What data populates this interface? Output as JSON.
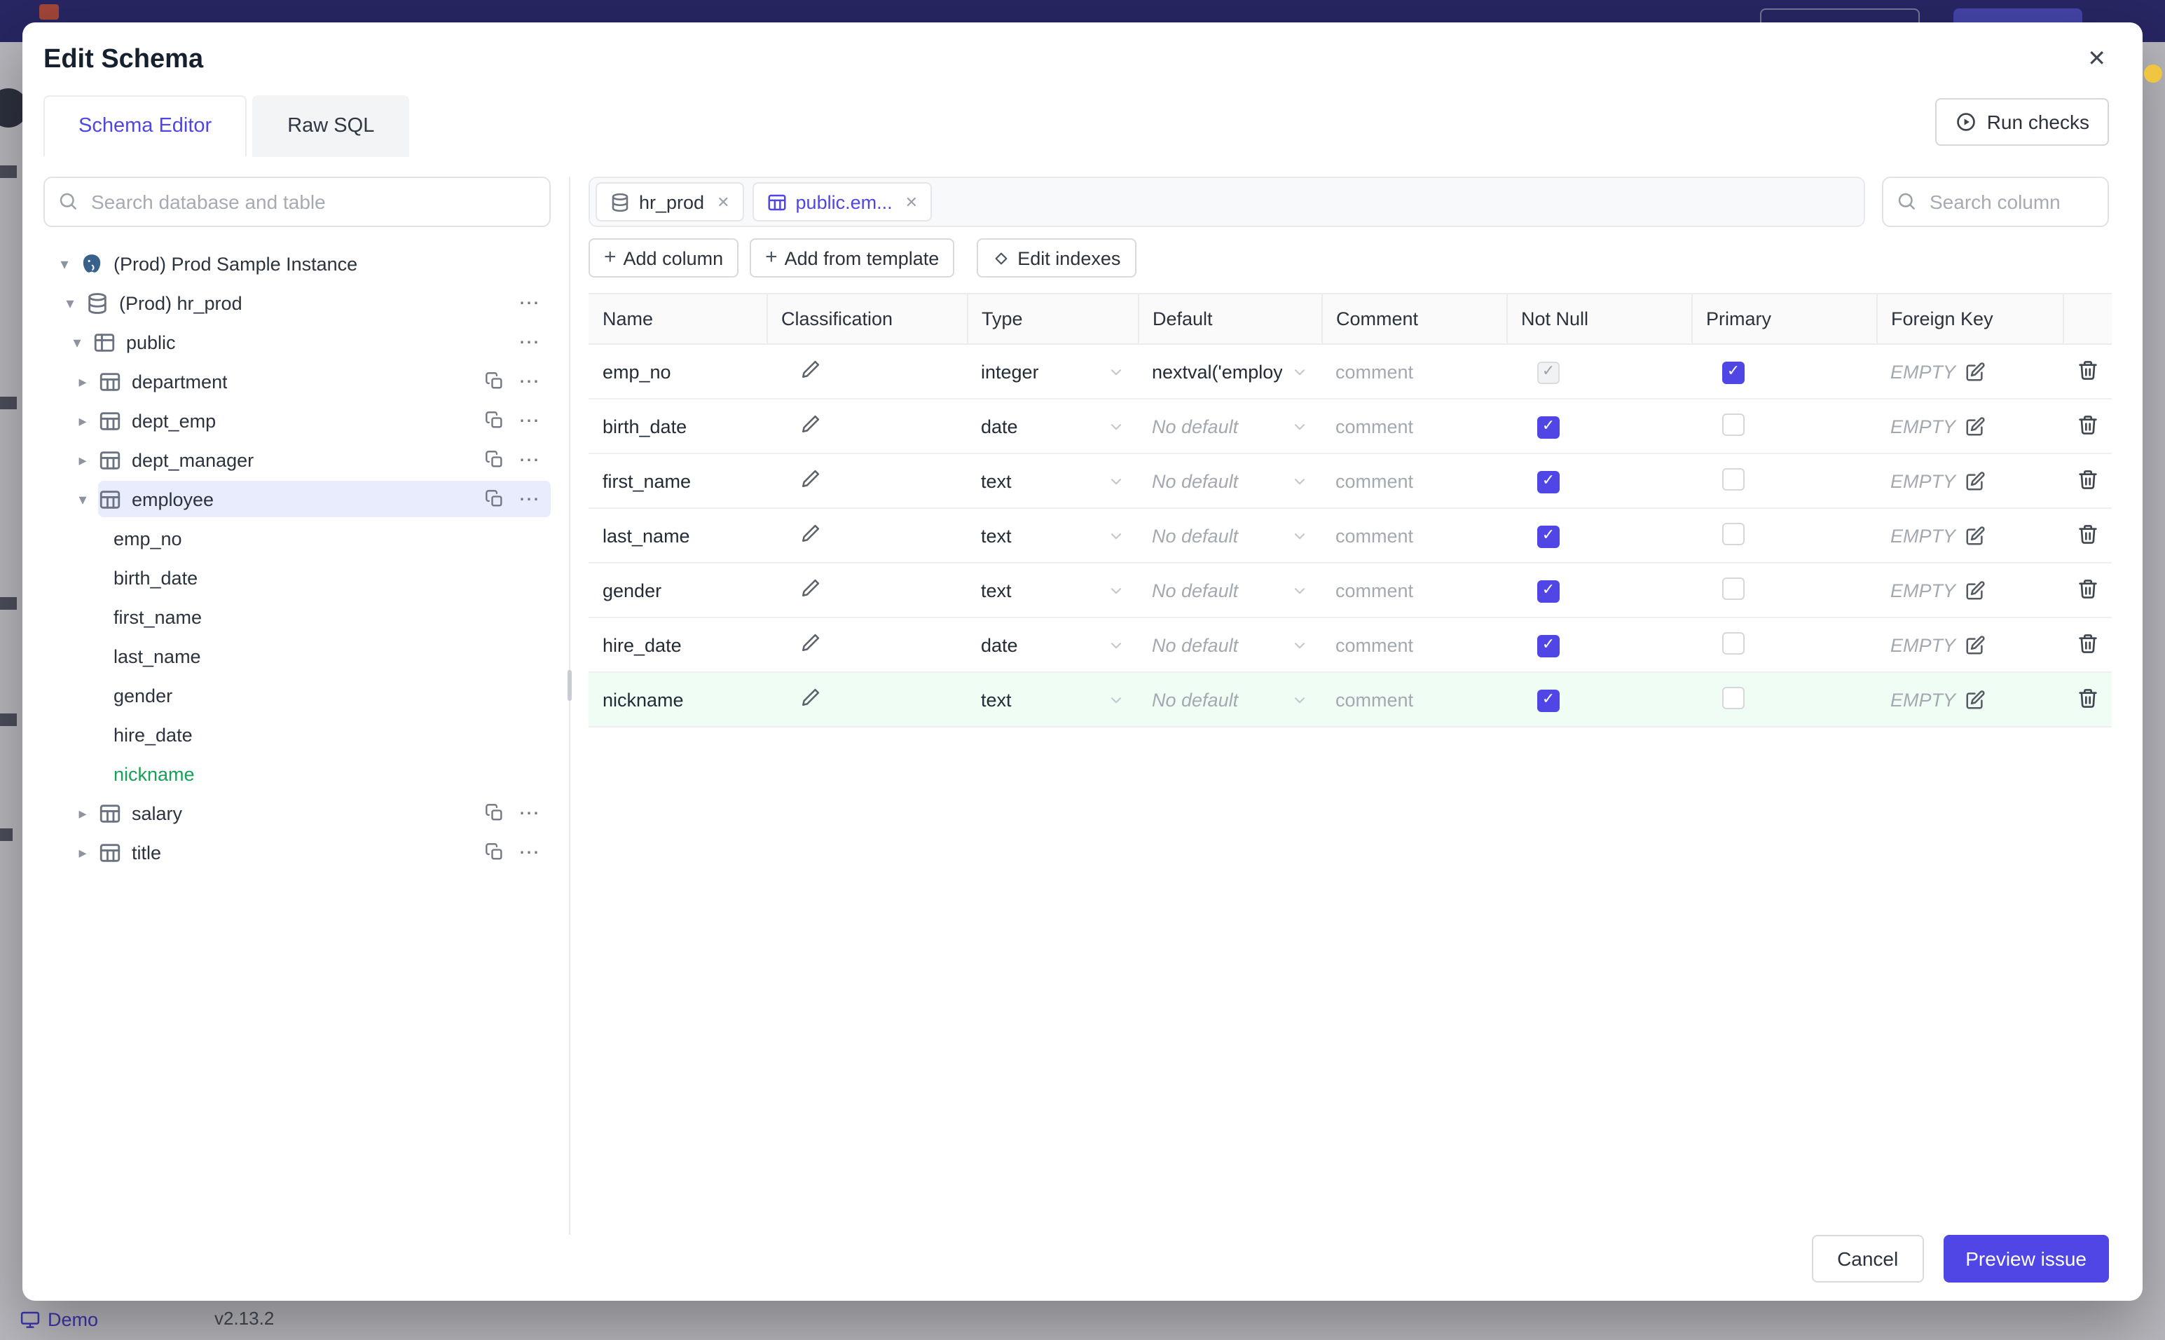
{
  "app": {
    "demo_label": "Demo",
    "version": "v2.13.2"
  },
  "modal": {
    "title": "Edit Schema",
    "close_icon": "✕"
  },
  "tabs": [
    {
      "label": "Schema Editor",
      "active": true
    },
    {
      "label": "Raw SQL",
      "active": false
    }
  ],
  "run_checks_label": "Run checks",
  "sidebar": {
    "search_placeholder": "Search database and table",
    "tree": [
      {
        "label": "(Prod) Prod Sample Instance",
        "kind": "instance",
        "icon": "postgres",
        "caret": "down",
        "actions": []
      },
      {
        "label": "(Prod) hr_prod",
        "kind": "database",
        "icon": "database",
        "caret": "down",
        "actions": [
          "more"
        ]
      },
      {
        "label": "public",
        "kind": "schema",
        "icon": "schema",
        "caret": "down",
        "actions": [
          "more"
        ]
      },
      {
        "label": "department",
        "kind": "table",
        "icon": "table",
        "caret": "right",
        "actions": [
          "copy",
          "more"
        ]
      },
      {
        "label": "dept_emp",
        "kind": "table",
        "icon": "table",
        "caret": "right",
        "actions": [
          "copy",
          "more"
        ]
      },
      {
        "label": "dept_manager",
        "kind": "table",
        "icon": "table",
        "caret": "right",
        "actions": [
          "copy",
          "more"
        ]
      },
      {
        "label": "employee",
        "kind": "table",
        "icon": "table",
        "caret": "down",
        "selected": true,
        "actions": [
          "copy",
          "more"
        ]
      },
      {
        "label": "emp_no",
        "kind": "column"
      },
      {
        "label": "birth_date",
        "kind": "column"
      },
      {
        "label": "first_name",
        "kind": "column"
      },
      {
        "label": "last_name",
        "kind": "column"
      },
      {
        "label": "gender",
        "kind": "column"
      },
      {
        "label": "hire_date",
        "kind": "column"
      },
      {
        "label": "nickname",
        "kind": "column",
        "green": true
      },
      {
        "label": "salary",
        "kind": "table",
        "icon": "table",
        "caret": "right",
        "actions": [
          "copy",
          "more"
        ]
      },
      {
        "label": "title",
        "kind": "table",
        "icon": "table",
        "caret": "right",
        "actions": [
          "copy",
          "more"
        ]
      }
    ]
  },
  "editor": {
    "chips": [
      {
        "label": "hr_prod",
        "icon": "database",
        "active": false
      },
      {
        "label": "public.em...",
        "icon": "table",
        "active": true
      }
    ],
    "search_column_placeholder": "Search column",
    "toolbar": [
      {
        "label": "Add column",
        "icon": "plus"
      },
      {
        "label": "Add from template",
        "icon": "plus"
      },
      {
        "label": "Edit indexes",
        "icon": "diamond"
      }
    ],
    "table": {
      "headers": [
        "Name",
        "Classification",
        "Type",
        "Default",
        "Comment",
        "Not Null",
        "Primary",
        "Foreign Key"
      ],
      "comment_placeholder": "comment",
      "empty_label": "EMPTY",
      "rows": [
        {
          "name": "emp_no",
          "type": "integer",
          "default": "nextval('employ",
          "default_muted": false,
          "not_null_checked": true,
          "not_null_disabled": true,
          "primary_checked": true,
          "highlight": false
        },
        {
          "name": "birth_date",
          "type": "date",
          "default": "No default",
          "default_muted": true,
          "not_null_checked": true,
          "not_null_disabled": false,
          "primary_checked": false,
          "highlight": false
        },
        {
          "name": "first_name",
          "type": "text",
          "default": "No default",
          "default_muted": true,
          "not_null_checked": true,
          "not_null_disabled": false,
          "primary_checked": false,
          "highlight": false
        },
        {
          "name": "last_name",
          "type": "text",
          "default": "No default",
          "default_muted": true,
          "not_null_checked": true,
          "not_null_disabled": false,
          "primary_checked": false,
          "highlight": false
        },
        {
          "name": "gender",
          "type": "text",
          "default": "No default",
          "default_muted": true,
          "not_null_checked": true,
          "not_null_disabled": false,
          "primary_checked": false,
          "highlight": false
        },
        {
          "name": "hire_date",
          "type": "date",
          "default": "No default",
          "default_muted": true,
          "not_null_checked": true,
          "not_null_disabled": false,
          "primary_checked": false,
          "highlight": false
        },
        {
          "name": "nickname",
          "type": "text",
          "default": "No default",
          "default_muted": true,
          "not_null_checked": true,
          "not_null_disabled": false,
          "primary_checked": false,
          "highlight": true
        }
      ]
    }
  },
  "footer": {
    "cancel_label": "Cancel",
    "primary_label": "Preview issue"
  },
  "colors": {
    "accent": "#4f46e5",
    "selected_tree_bg": "#e8ecfc",
    "new_item_green": "#18a058",
    "new_row_bg": "#f0fdf4",
    "header_bar": "#33307e"
  }
}
